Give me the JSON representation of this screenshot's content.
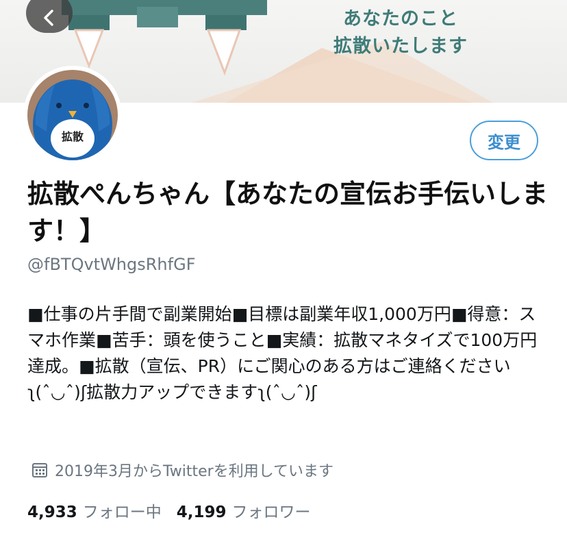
{
  "header": {
    "banner_text": [
      "あなたのこと",
      "拡散いたします"
    ],
    "back_icon": "chevron-left-icon"
  },
  "profile": {
    "avatar_label": "拡散",
    "edit_button_label": "変更",
    "display_name": "拡散ぺんちゃん【あなたの宣伝お手伝いします！】",
    "handle": "@fBTQvtWhgsRhfGF",
    "bio": "■仕事の片手間で副業開始■目標は副業年収1,000万円■得意：スマホ作業■苦手：頭を使うこと■実績：拡散マネタイズで100万円達成。■拡散（宣伝、PR）にご関心のある方はご連絡くださいʅ(ˆ◡ˆ)ʃ拡散力アップできますʅ(ˆ◡ˆ)ʃ",
    "joined": "2019年3月からTwitterを利用しています",
    "calendar_icon": "calendar-icon"
  },
  "stats": {
    "following_count": "4,933",
    "following_label": "フォロー中",
    "followers_count": "4,199",
    "followers_label": "フォロワー"
  },
  "colors": {
    "accent": "#4a9fd8",
    "banner_text": "#3f7c78",
    "muted": "#6b7680"
  }
}
